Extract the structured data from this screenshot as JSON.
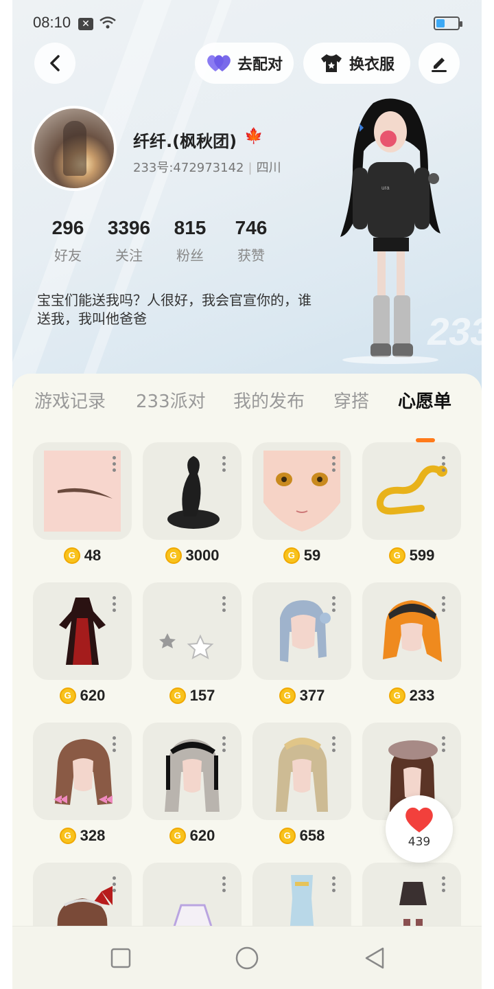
{
  "status_bar": {
    "time": "08:10"
  },
  "header": {
    "match_label": "去配对",
    "dress_label": "换衣服"
  },
  "profile": {
    "name": "纤纤.(枫秋团)",
    "uid": "233号:472973142",
    "region": "四川",
    "stats": [
      {
        "value": "296",
        "label": "好友"
      },
      {
        "value": "3396",
        "label": "关注"
      },
      {
        "value": "815",
        "label": "粉丝"
      },
      {
        "value": "746",
        "label": "获赞"
      }
    ],
    "bio": "宝宝们能送我吗？人很好，我会官宣你的，谁送我，我叫他爸爸"
  },
  "character_badge": "233",
  "tabs": [
    {
      "label": "游戏记录",
      "active": false
    },
    {
      "label": "233派对",
      "active": false
    },
    {
      "label": "我的发布",
      "active": false
    },
    {
      "label": "穿搭",
      "active": false
    },
    {
      "label": "心愿单",
      "active": true
    }
  ],
  "wishlist": [
    {
      "item": "eyebrow",
      "price": "48"
    },
    {
      "item": "cobra",
      "price": "3000"
    },
    {
      "item": "face",
      "price": "59"
    },
    {
      "item": "golden-dragon",
      "price": "599"
    },
    {
      "item": "red-black-dress",
      "price": "620"
    },
    {
      "item": "stars-effect",
      "price": "157"
    },
    {
      "item": "blue-braids-hair",
      "price": "377"
    },
    {
      "item": "orange-hair-cap",
      "price": "233"
    },
    {
      "item": "brown-hair-bows",
      "price": "328"
    },
    {
      "item": "maid-headdress-hair",
      "price": "620"
    },
    {
      "item": "blonde-braid-hair",
      "price": "658"
    },
    {
      "item": "beret-hair",
      "price": ""
    },
    {
      "item": "red-bow-hair",
      "price": ""
    },
    {
      "item": "lilac-skirt",
      "price": ""
    },
    {
      "item": "blue-outfit",
      "price": ""
    },
    {
      "item": "dark-skirt",
      "price": ""
    }
  ],
  "like_count": "439",
  "colors": {
    "accent": "#ff7a1a",
    "coin": "#f8c21c",
    "heart": "#f2403c",
    "panel": "#f7f7ef"
  }
}
